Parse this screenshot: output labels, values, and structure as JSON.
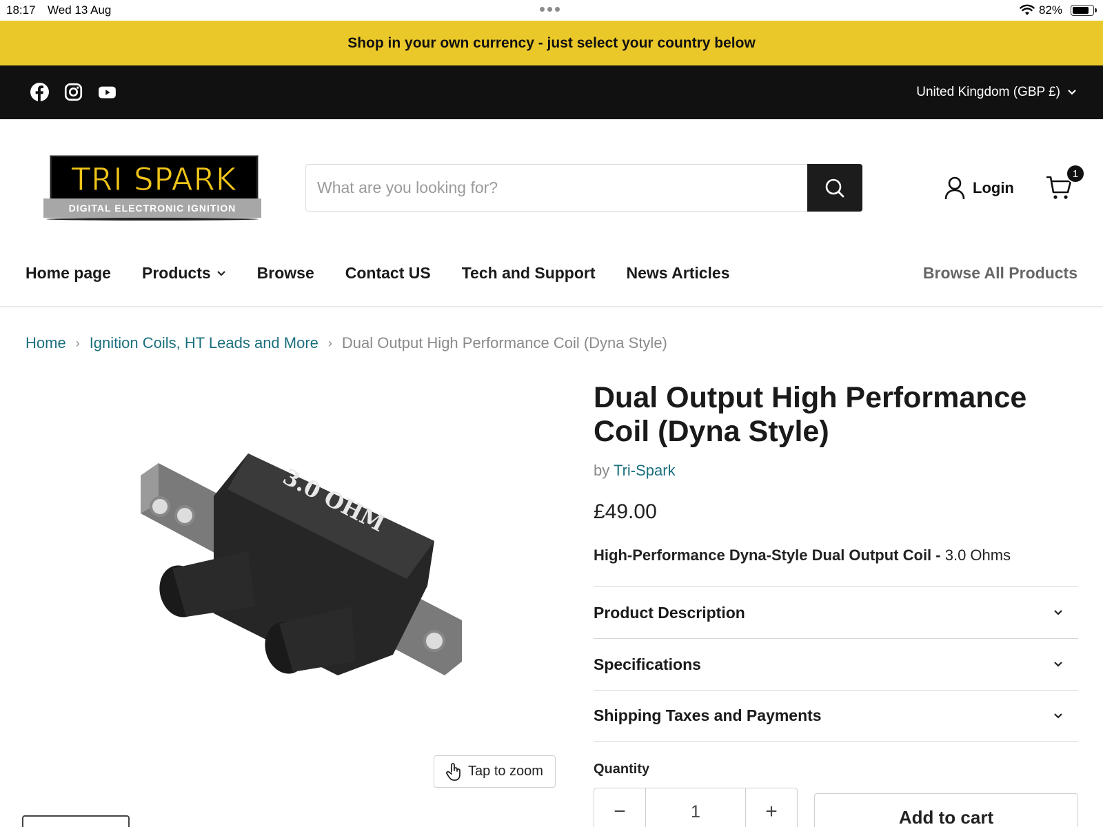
{
  "status_bar": {
    "time": "18:17",
    "date": "Wed 13 Aug",
    "battery": "82%",
    "battery_level": 0.82
  },
  "announcement": "Shop in your own currency - just select your country below",
  "social": {
    "icons": [
      "facebook-icon",
      "instagram-icon",
      "youtube-icon"
    ]
  },
  "currency": {
    "selected": "United Kingdom (GBP £)"
  },
  "logo": {
    "main": "TRI SPARK",
    "tagline": "DIGITAL ELECTRONIC IGNITION"
  },
  "search": {
    "placeholder": "What are you looking for?",
    "value": ""
  },
  "account": {
    "login_label": "Login"
  },
  "cart": {
    "count": "1"
  },
  "nav": {
    "items": [
      {
        "label": "Home page"
      },
      {
        "label": "Products"
      },
      {
        "label": "Browse"
      },
      {
        "label": "Contact US"
      },
      {
        "label": "Tech and Support"
      },
      {
        "label": "News Articles"
      }
    ],
    "browse_all": "Browse All Products"
  },
  "breadcrumb": {
    "home": "Home",
    "category": "Ignition Coils, HT Leads and More",
    "current": "Dual Output High Performance Coil (Dyna Style)"
  },
  "product": {
    "image_label": "3.0 OHM",
    "zoom_label": "Tap to zoom",
    "title": "Dual Output High Performance Coil (Dyna Style)",
    "vendor_prefix": "by",
    "vendor": "Tri-Spark",
    "price": "£49.00",
    "short_desc_bold": "High-Performance Dyna-Style Dual Output Coil -",
    "short_desc_rest": " 3.0 Ohms",
    "accordion": [
      {
        "label": "Product Description"
      },
      {
        "label": "Specifications"
      },
      {
        "label": "Shipping Taxes and Payments"
      }
    ],
    "quantity_label": "Quantity",
    "quantity": "1",
    "minus": "−",
    "plus": "+",
    "add_to_cart": "Add to cart"
  },
  "colors": {
    "accent_yellow": "#ebc829",
    "link_teal": "#1a6f7e",
    "dark": "#111111"
  }
}
